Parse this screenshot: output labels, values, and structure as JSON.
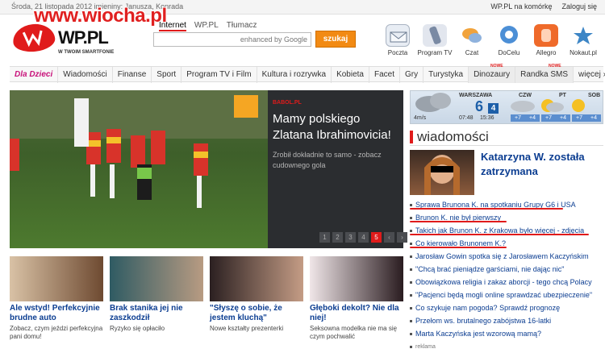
{
  "top": {
    "date": "Środa, 21 listopada 2012 imieniny: Janusza, Konrada",
    "links": [
      "WP.PL na komórkę",
      "Zaloguj się"
    ],
    "watermark": "www.wiocha.pl"
  },
  "logo": {
    "text": "WP.PL",
    "tagline": "W TWOIM SMARTFONIE"
  },
  "search": {
    "tabs": [
      "Internet",
      "WP.PL",
      "Tłumacz"
    ],
    "placeholder": "enhanced by Google",
    "button": "szukaj"
  },
  "services": [
    {
      "label": "Poczta",
      "icon": "mail-icon",
      "color": "#e8edf4"
    },
    {
      "label": "Program TV",
      "icon": "remote-icon",
      "color": "#e2e6ee"
    },
    {
      "label": "Czat",
      "icon": "chat-icon",
      "color": "#f1a33c"
    },
    {
      "label": "DoCelu",
      "icon": "docelu-icon",
      "color": "#4c8fd6"
    },
    {
      "label": "Allegro",
      "icon": "hand-icon",
      "color": "#ef6a2a"
    },
    {
      "label": "Nokaut.pl",
      "icon": "nokaut-icon",
      "color": "#3d86c6"
    }
  ],
  "nav": {
    "items": [
      "Dla Dzieci",
      "Wiadomości",
      "Finanse",
      "Sport",
      "Program TV i Film",
      "Kultura i rozrywka",
      "Kobieta",
      "Facet",
      "Gry",
      "Turystyka",
      "Dinozaury",
      "Randka SMS",
      "więcej ›"
    ],
    "new_badge": "NOWE"
  },
  "hero": {
    "source": "BABOL.PL",
    "title": "Mamy polskiego Zlatana Ibrahimovicia!",
    "description": "Zrobił dokładnie to samo - zobacz cudownego gola",
    "pages": [
      "1",
      "2",
      "3",
      "4",
      "5"
    ],
    "current_page": "5"
  },
  "thumbs": [
    {
      "title": "Ale wstyd! Perfekcyjnie brudne auto",
      "subtitle": "Zobacz, czym jeździ perfekcyjna pani domu!"
    },
    {
      "title": "Brak stanika jej nie zaszkodził",
      "subtitle": "Ryzyko się opłaciło"
    },
    {
      "title": "\"Słyszę o sobie, że jestem kluchą\"",
      "subtitle": "Nowe kształty prezenterki"
    },
    {
      "title": "Głęboki dekolt? Nie dla niej!",
      "subtitle": "Seksowna modelka nie ma się czym pochwalić"
    }
  ],
  "weather": {
    "city": "WARSZAWA",
    "temp": "6",
    "badge": "4",
    "wind": "4m/s",
    "time": "15:36",
    "time2": "07:48",
    "days": [
      {
        "label": "CZW",
        "low": "+7",
        "high": "+4"
      },
      {
        "label": "PT",
        "low": "+7",
        "high": "+4"
      },
      {
        "label": "SOB",
        "low": "+7",
        "high": "+4"
      }
    ]
  },
  "news": {
    "heading": "wiadomości",
    "lead": "Katarzyna W. została zatrzymana",
    "items": [
      "Sprawa Brunona K. na spotkaniu Grupy G6 i USA",
      "Brunon K. nie był pierwszy",
      "Takich jak Brunon K. z Krakowa było więcej - zdjęcia",
      "Co kierowało Brunonem K.?",
      "Jarosław Gowin spotka się z Jarosławem Kaczyńskim",
      "\"Chcą brać pieniądze garściami, nie dając nic\"",
      "Obowiązkowa religia i zakaz aborcji - tego chcą Polacy",
      "\"Pacjenci będą mogli online sprawdzać ubezpieczenie\"",
      "Co szykuje nam pogoda? Sprawdź prognozę",
      "Przełom ws. brutalnego zabójstwa 16-latki",
      "Marta Kaczyńska jest wzorową mamą?"
    ],
    "footer": "reklama"
  },
  "colors": {
    "brand": "#e01b1b",
    "link": "#0b3d91",
    "search_button": "#f28a13"
  }
}
